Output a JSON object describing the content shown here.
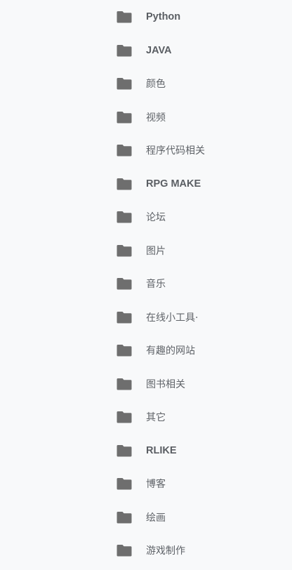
{
  "folders": [
    {
      "label": "Python",
      "icon": "folder-icon",
      "latin": true
    },
    {
      "label": "JAVA",
      "icon": "folder-icon",
      "latin": true
    },
    {
      "label": "颜色",
      "icon": "folder-icon",
      "latin": false
    },
    {
      "label": "视频",
      "icon": "folder-icon",
      "latin": false
    },
    {
      "label": "程序代码相关",
      "icon": "folder-icon",
      "latin": false
    },
    {
      "label": "RPG MAKE",
      "icon": "folder-icon",
      "latin": true
    },
    {
      "label": "论坛",
      "icon": "folder-icon",
      "latin": false
    },
    {
      "label": "图片",
      "icon": "folder-icon",
      "latin": false
    },
    {
      "label": "音乐",
      "icon": "folder-icon",
      "latin": false
    },
    {
      "label": "在线小工具·",
      "icon": "folder-icon",
      "latin": false
    },
    {
      "label": "有趣的网站",
      "icon": "folder-icon",
      "latin": false
    },
    {
      "label": "图书相关",
      "icon": "folder-icon",
      "latin": false
    },
    {
      "label": "其它",
      "icon": "folder-icon",
      "latin": false
    },
    {
      "label": "RLIKE",
      "icon": "folder-icon",
      "latin": true
    },
    {
      "label": "博客",
      "icon": "folder-icon",
      "latin": false
    },
    {
      "label": "绘画",
      "icon": "folder-icon",
      "latin": false
    },
    {
      "label": "游戏制作",
      "icon": "folder-icon",
      "latin": false
    }
  ],
  "colors": {
    "background": "#f8f9fa",
    "folder_icon": "#6e6e6e",
    "label_text": "#5f6368"
  }
}
